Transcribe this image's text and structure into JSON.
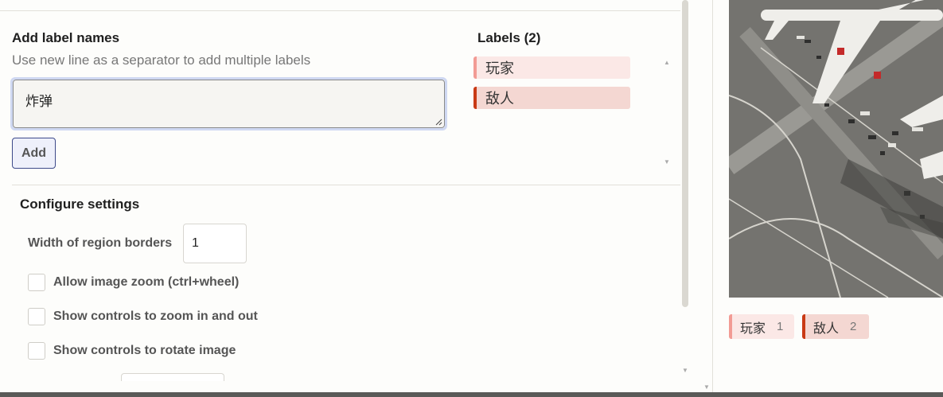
{
  "add_labels": {
    "title": "Add label names",
    "description": "Use new line as a separator to add multiple labels",
    "textarea_value": "炸弹",
    "add_button": "Add"
  },
  "labels_panel": {
    "title": "Labels (2)",
    "items": [
      {
        "label": "玩家",
        "color": "#f29b94"
      },
      {
        "label": "敌人",
        "color": "#c93a15"
      }
    ]
  },
  "config": {
    "title": "Configure settings",
    "width_label": "Width of region borders",
    "width_value": "1",
    "checkboxes": [
      {
        "label": "Allow image zoom (ctrl+wheel)",
        "checked": false
      },
      {
        "label": "Show controls to zoom in and out",
        "checked": false
      },
      {
        "label": "Show controls to rotate image",
        "checked": false
      }
    ]
  },
  "legend": [
    {
      "label": "玩家",
      "count": "1",
      "color": "#f29b94"
    },
    {
      "label": "敌人",
      "count": "2",
      "color": "#c93a15"
    }
  ]
}
